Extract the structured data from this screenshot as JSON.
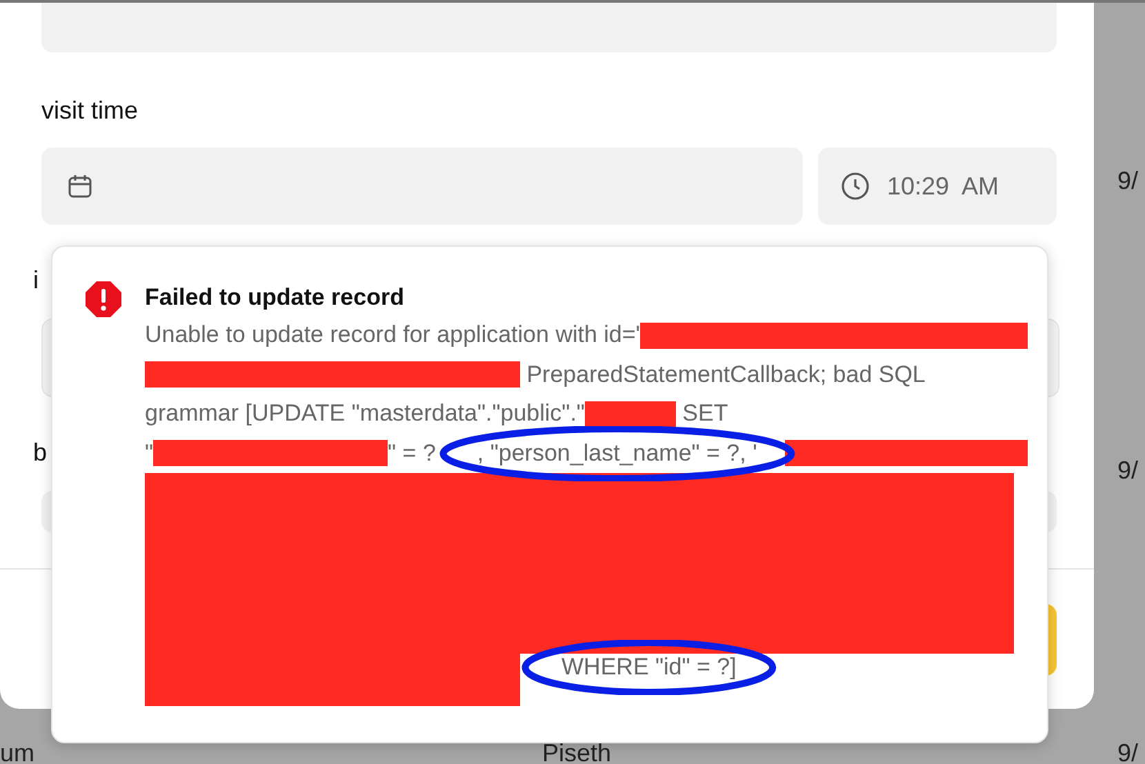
{
  "background_table": {
    "cells": [
      {
        "text": "9/"
      },
      {
        "text": "9/"
      },
      {
        "text": "um"
      },
      {
        "text": "Piseth"
      },
      {
        "text": "9/"
      }
    ]
  },
  "modal": {
    "visit_time_label": "visit time",
    "time_field": {
      "value": "10:29  AM"
    },
    "hidden_labels": [
      "i",
      "b"
    ]
  },
  "toast": {
    "kind": "error",
    "title": "Failed to update record",
    "message_lines": [
      [
        {
          "kind": "text",
          "text": "Unable to update record for application with id='",
          "highlighted": false
        },
        {
          "kind": "redaction"
        }
      ],
      [
        {
          "kind": "redaction"
        },
        {
          "kind": "text",
          "text": " PreparedStatementCallback; bad SQL",
          "highlighted": false
        }
      ],
      [
        {
          "kind": "text",
          "text": "grammar [UPDATE \"masterdata\".\"public\".\"",
          "highlighted": false
        },
        {
          "kind": "redaction"
        },
        {
          "kind": "text",
          "text": " SET",
          "highlighted": false
        }
      ],
      [
        {
          "kind": "text",
          "text": "\"",
          "highlighted": false
        },
        {
          "kind": "redaction"
        },
        {
          "kind": "text",
          "text": "\" = ?",
          "highlighted": false
        },
        {
          "kind": "text",
          "text": ", \"person_last_name\" = ?, '",
          "highlighted": true
        },
        {
          "kind": "redaction"
        }
      ],
      [
        {
          "kind": "redaction"
        }
      ],
      [
        {
          "kind": "redaction"
        },
        {
          "kind": "text",
          "text": "WHERE \"id\" = ?]",
          "highlighted": true
        }
      ]
    ]
  }
}
